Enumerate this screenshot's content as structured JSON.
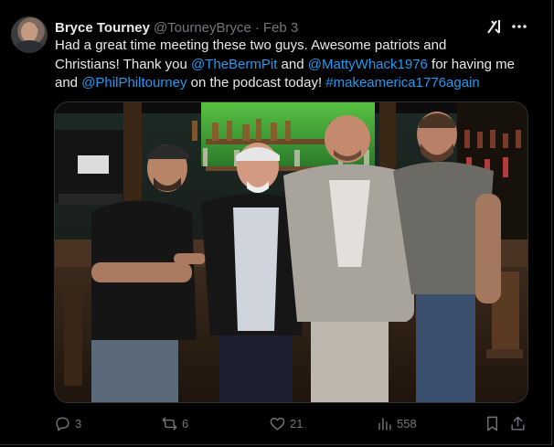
{
  "tweet": {
    "author": {
      "display_name": "Bryce Tourney",
      "handle": "@TourneyBryce",
      "separator": "·",
      "date": "Feb 3"
    },
    "text": {
      "line1": "Had a great time meeting these two guys. Awesome patriots and",
      "line2_a": "Christians! Thank you ",
      "mention1": "@TheBermPit",
      "line2_b": " and ",
      "mention2": "@MattyWhack1976",
      "line2_c": " for having me",
      "line3_a": "and ",
      "mention3": "@PhilPhiltourney",
      "line3_b": " on the podcast today! ",
      "hashtag": "#makeamerica1776again"
    },
    "actions": {
      "replies": "3",
      "reposts": "6",
      "likes": "21",
      "views": "558"
    }
  },
  "icons": {
    "grok": "grok-icon",
    "more": "more-icon",
    "reply": "reply-icon",
    "repost": "repost-icon",
    "like": "heart-icon",
    "views": "views-icon",
    "bookmark": "bookmark-icon",
    "share": "share-icon"
  },
  "colors": {
    "background": "#000000",
    "text": "#e7e9ea",
    "secondary": "#71767b",
    "link": "#1d9bf0",
    "border": "#2f3336"
  }
}
